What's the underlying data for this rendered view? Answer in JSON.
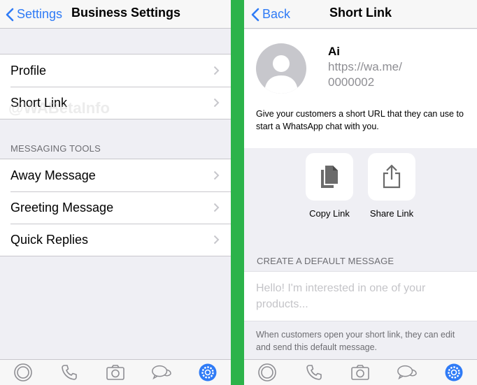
{
  "left": {
    "nav": {
      "back_label": "Settings",
      "title": "Business Settings"
    },
    "rows_top": [
      {
        "label": "Profile"
      },
      {
        "label": "Short Link"
      }
    ],
    "section_header": "MESSAGING TOOLS",
    "rows_tools": [
      {
        "label": "Away Message"
      },
      {
        "label": "Greeting Message"
      },
      {
        "label": "Quick Replies"
      }
    ],
    "watermark": "@WABetaInfo"
  },
  "right": {
    "nav": {
      "back_label": "Back",
      "title": "Short Link"
    },
    "profile": {
      "name": "Ai",
      "link_line1": "https://wa.me/",
      "link_line2": "0000002"
    },
    "description": "Give your customers a short URL that they can use to start a WhatsApp chat with you.",
    "actions": [
      {
        "label": "Copy Link",
        "icon": "copy-icon"
      },
      {
        "label": "Share Link",
        "icon": "share-icon"
      }
    ],
    "section_header": "CREATE A DEFAULT MESSAGE",
    "message_placeholder": "Hello! I'm interested in one of your products...",
    "message_value": "",
    "footer_note": "When customers open your short link, they can edit and send this default message."
  },
  "tabbar": [
    {
      "icon": "status-icon"
    },
    {
      "icon": "calls-icon"
    },
    {
      "icon": "camera-icon"
    },
    {
      "icon": "chats-icon"
    },
    {
      "icon": "settings-icon",
      "active": true
    }
  ],
  "colors": {
    "accent": "#2f7bf6",
    "divider_green": "#2cb34a",
    "inactive_icon": "#8e8e93",
    "active_icon": "#2f7bf6"
  }
}
